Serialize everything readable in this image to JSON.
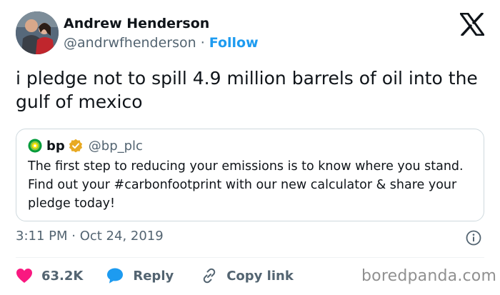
{
  "author": {
    "name": "Andrew Henderson",
    "handle": "@andrwfhenderson",
    "separator": "·",
    "follow_label": "Follow"
  },
  "tweet": {
    "text": "i pledge not to spill 4.9 million barrels of oil into the gulf of mexico"
  },
  "quote": {
    "name": "bp",
    "handle": "@bp_plc",
    "text": "The first step to reducing your emissions is to know where you stand. Find out your #carbonfootprint with our new calculator & share your pledge today!",
    "logo_icon": "bp-helios-logo-icon",
    "verified_icon": "gold-verified-badge-icon"
  },
  "meta": {
    "timestamp": "3:11 PM · Oct 24, 2019"
  },
  "actions": {
    "like_count": "63.2K",
    "reply_label": "Reply",
    "copy_label": "Copy link"
  },
  "watermark": "boredpanda.com",
  "colors": {
    "text": "#0f1419",
    "muted": "#536471",
    "accent": "#1d9bf0",
    "like": "#f91880",
    "border": "#cfd9de"
  }
}
